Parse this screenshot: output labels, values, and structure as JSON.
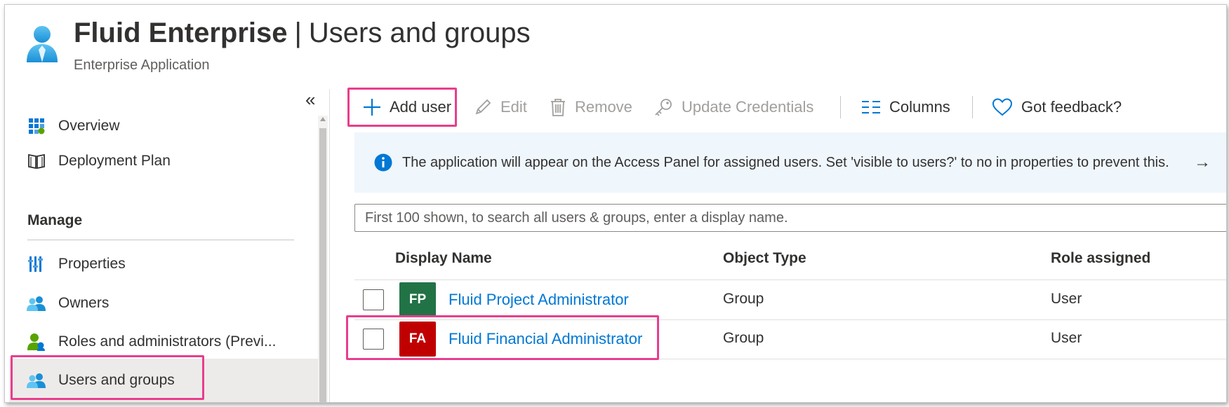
{
  "header": {
    "app_name": "Fluid Enterprise",
    "separator": "|",
    "page_title": "Users and groups",
    "subtitle": "Enterprise Application",
    "app_icon": "user-icon"
  },
  "sidebar": {
    "collapse_glyph": "«",
    "items": [
      {
        "label": "Overview",
        "icon": "grid-icon"
      },
      {
        "label": "Deployment Plan",
        "icon": "book-icon"
      }
    ],
    "section_title": "Manage",
    "manage_items": [
      {
        "label": "Properties",
        "icon": "properties-icon"
      },
      {
        "label": "Owners",
        "icon": "owners-icon"
      },
      {
        "label": "Roles and administrators (Previ...",
        "icon": "roles-icon"
      },
      {
        "label": "Users and groups",
        "icon": "users-groups-icon",
        "selected": true
      }
    ]
  },
  "toolbar": {
    "add_user": "Add user",
    "edit": "Edit",
    "remove": "Remove",
    "update_credentials": "Update Credentials",
    "columns": "Columns",
    "feedback": "Got feedback?"
  },
  "banner": {
    "message": "The application will appear on the Access Panel for assigned users. Set 'visible to users?' to no in properties to prevent this.",
    "arrow": "→"
  },
  "search": {
    "placeholder": "First 100 shown, to search all users & groups, enter a display name."
  },
  "table": {
    "columns": [
      "Display Name",
      "Object Type",
      "Role assigned"
    ],
    "rows": [
      {
        "initials": "FP",
        "avatar_color": "#217346",
        "display_name": "Fluid Project Administrator",
        "object_type": "Group",
        "role": "User"
      },
      {
        "initials": "FA",
        "avatar_color": "#c00000",
        "display_name": "Fluid Financial Administrator",
        "object_type": "Group",
        "role": "User"
      }
    ]
  },
  "colors": {
    "accent": "#0078d4",
    "highlight": "#e83e8c"
  }
}
